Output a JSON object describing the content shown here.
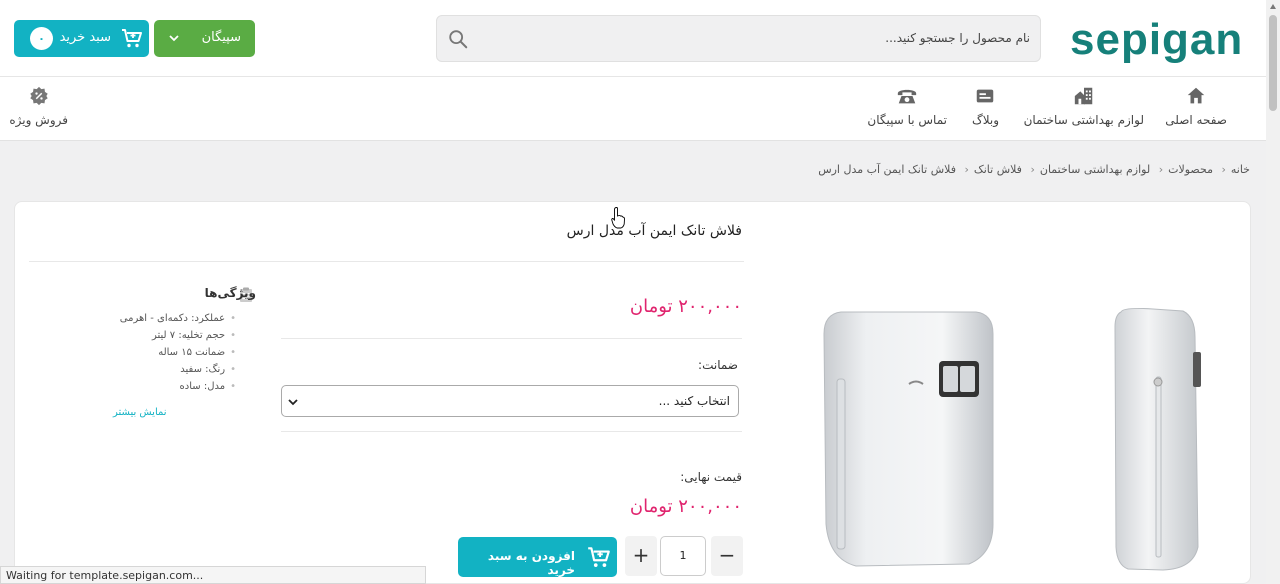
{
  "header": {
    "logo": "sepigan",
    "search_placeholder": "نام محصول را جستجو کنید...",
    "sepigan_button": "سپیگان",
    "cart_button": "سبد خرید",
    "cart_count": "۰"
  },
  "nav": {
    "items": [
      {
        "label": "صفحه اصلی",
        "icon": "home-icon"
      },
      {
        "label": "لوازم بهداشتی ساختمان",
        "icon": "building-icon"
      },
      {
        "label": "وبلاگ",
        "icon": "blog-icon"
      },
      {
        "label": "تماس با سپیگان",
        "icon": "phone-icon"
      },
      {
        "label": "فروش ویژه",
        "icon": "discount-icon"
      }
    ]
  },
  "breadcrumb": [
    "خانه",
    "محصولات",
    "لوازم بهداشتی ساختمان",
    "فلاش تانک",
    "فلاش تانک ایمن آب مدل ارس"
  ],
  "product": {
    "title": "فلاش تانک ایمن آب مدل ارس",
    "price": "۲۰۰,۰۰۰ تومان",
    "guarantee_label": "ضمانت:",
    "guarantee_select": "انتخاب کنید ...",
    "final_price_label": "قیمت نهایی:",
    "final_price": "۲۰۰,۰۰۰ تومان",
    "quantity": "1",
    "minus": "−",
    "plus": "+",
    "add_to_cart": "افزودن به سبد خرید"
  },
  "features": {
    "title": "ویژگی‌ها",
    "items": [
      "عملکرد: دکمه‌ای - اهرمی",
      "حجم تخلیه: ۷ لیتر",
      "ضمانت ۱۵ ساله",
      "رنگ: سفید",
      "مدل: ساده"
    ],
    "show_more": "نمایش بیشتر"
  },
  "status_bar": "Waiting for template.sepigan.com...",
  "colors": {
    "brand": "#16807a",
    "green_button": "#5aac44",
    "cyan_button": "#12b2c3",
    "price": "#e0246e"
  }
}
